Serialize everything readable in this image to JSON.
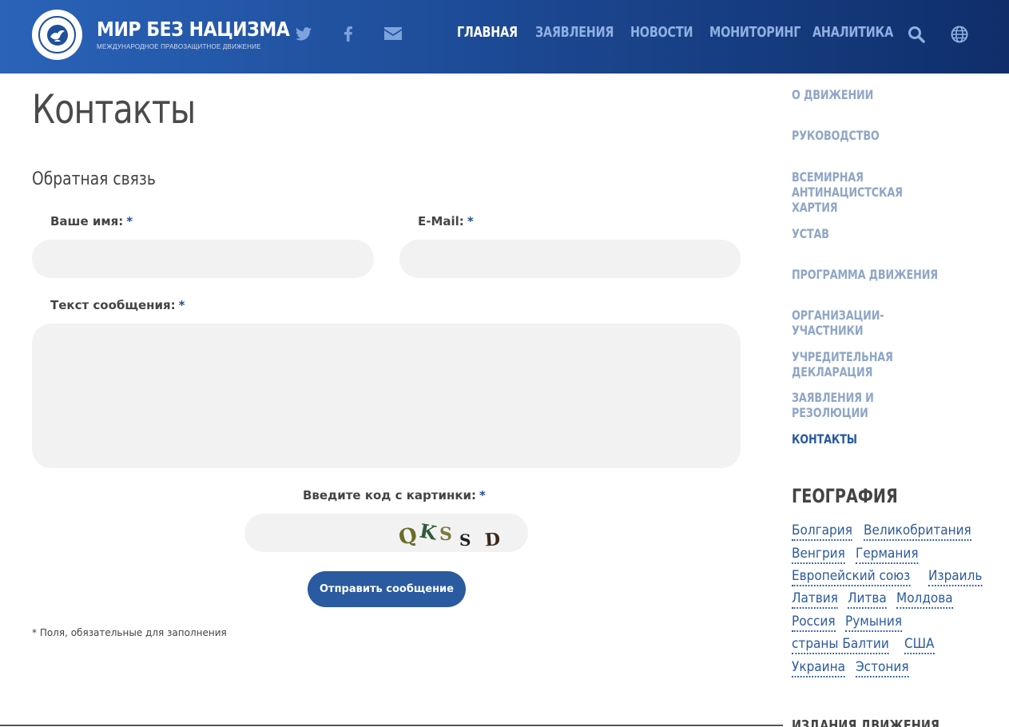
{
  "header": {
    "site_title": "МИР БЕЗ НАЦИЗМА",
    "site_subtitle": "МЕЖДУНАРОДНОЕ ПРАВОЗАЩИТНОЕ ДВИЖЕНИЕ",
    "social_icons": [
      "twitter-icon",
      "facebook-icon",
      "envelope-icon"
    ],
    "nav": [
      {
        "label": "ГЛАВНАЯ",
        "active": true
      },
      {
        "label": "ЗАЯВЛЕНИЯ",
        "active": false
      },
      {
        "label": "НОВОСТИ",
        "active": false
      },
      {
        "label": "МОНИТОРИНГ",
        "active": false
      },
      {
        "label": "АНАЛИТИКА",
        "active": false
      }
    ],
    "tool_icons": [
      "search-icon",
      "globe-icon"
    ],
    "colors": {
      "gradient_start": "#2a63b8",
      "gradient_end": "#0f2e6a",
      "nav_inactive": "#8fb0e2",
      "nav_active": "#ffffff"
    }
  },
  "main": {
    "page_title": "Контакты",
    "section_title": "Обратная связь",
    "form": {
      "name_label": "Ваше имя:",
      "email_label": "E-Mail:",
      "message_label": "Текст сообщения:",
      "captcha_label": "Введите код с картинки:",
      "required_mark": "*",
      "name_value": "",
      "email_value": "",
      "message_value": "",
      "captcha_value": "",
      "captcha_code": "QKSSD",
      "submit_label": "Отправить сообщение",
      "required_note": "* Поля, обязательные для заполнения"
    }
  },
  "sidebar": {
    "links": [
      {
        "label": "О ДВИЖЕНИИ",
        "current": false
      },
      {
        "label": "РУКОВОДСТВО",
        "current": false
      },
      {
        "label": "ВСЕМИРНАЯ АНТИНАЦИСТСКАЯ ХАРТИЯ",
        "current": false
      },
      {
        "label": "УСТАВ",
        "current": false
      },
      {
        "label": "ПРОГРАММА ДВИЖЕНИЯ",
        "current": false
      },
      {
        "label": "ОРГАНИЗАЦИИ-УЧАСТНИКИ",
        "current": false
      },
      {
        "label": "УЧРЕДИТЕЛЬНАЯ ДЕКЛАРАЦИЯ",
        "current": false
      },
      {
        "label": "ЗАЯВЛЕНИЯ И РЕЗОЛЮЦИИ",
        "current": false
      },
      {
        "label": "КОНТАКТЫ",
        "current": true
      }
    ],
    "geo_title": "ГЕОГРАФИЯ",
    "geo_rows": [
      [
        "Болгария",
        "Великобритания"
      ],
      [
        "Венгрия",
        "Германия"
      ],
      [
        "Европейский союз",
        "Израиль"
      ],
      [
        "Латвия",
        "Литва",
        "Молдова"
      ],
      [
        "Россия",
        "Румыния"
      ],
      [
        "страны Балтии",
        "США"
      ],
      [
        "Украина",
        "Эстония"
      ]
    ],
    "next_heading": "ИЗДАНИЯ ДВИЖЕНИЯ",
    "colors": {
      "link": "#8fa6c6",
      "current": "#2a5aa0",
      "tag": "#2a5aa0"
    }
  }
}
